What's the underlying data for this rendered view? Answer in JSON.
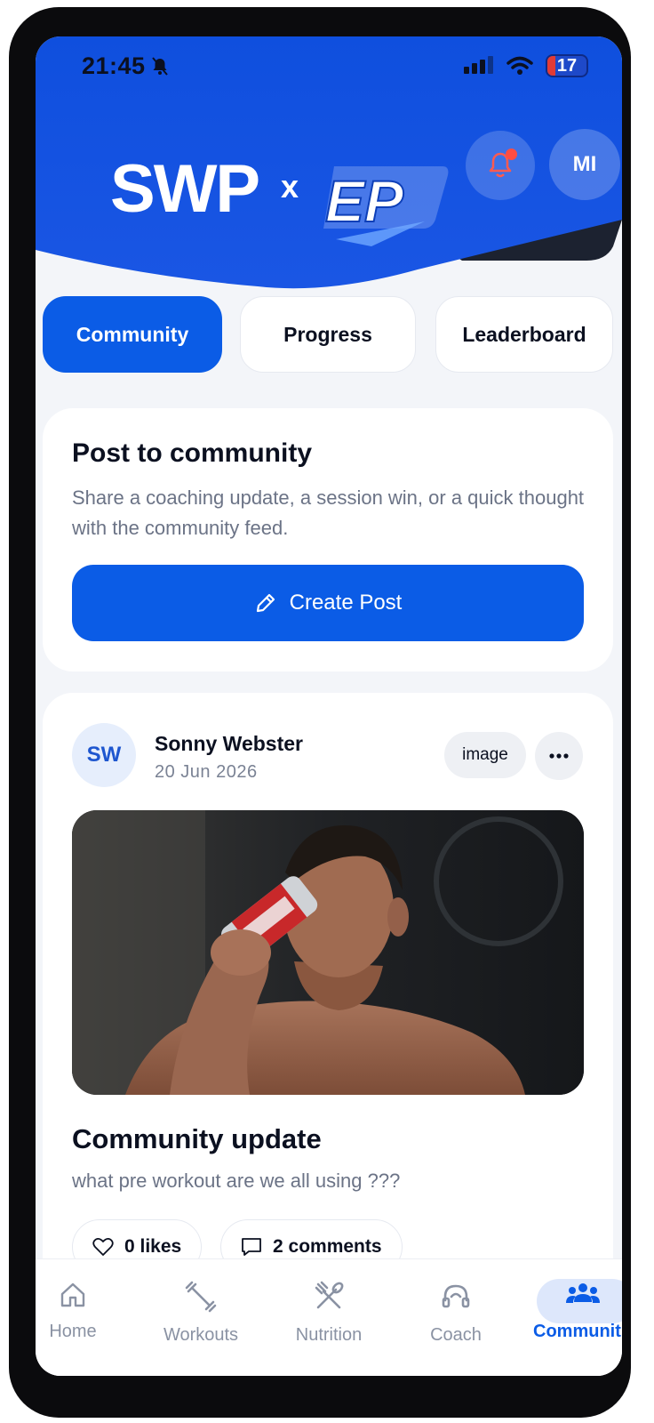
{
  "status_bar": {
    "time": "21:45",
    "battery": "17"
  },
  "header": {
    "brand_left": "SWP",
    "brand_sep": "x",
    "brand_right": "EP",
    "avatar_initials": "MI"
  },
  "tabs": [
    {
      "label": "Community",
      "active": true
    },
    {
      "label": "Progress",
      "active": false
    },
    {
      "label": "Leaderboard",
      "active": false
    }
  ],
  "composer": {
    "title": "Post to community",
    "description": "Share a coaching update, a session win, or a quick thought with the community feed.",
    "button_label": "Create Post"
  },
  "post": {
    "author_initials": "SW",
    "author_name": "Sonny Webster",
    "date": "20 Jun 2026",
    "type_chip": "image",
    "title": "Community update",
    "body": "what pre workout are we all using ???",
    "likes_label": "0 likes",
    "comments_label": "2 comments"
  },
  "bottom_nav": [
    {
      "label": "Home",
      "icon": "home-icon",
      "active": false
    },
    {
      "label": "Workouts",
      "icon": "dumbbell-icon",
      "active": false
    },
    {
      "label": "Nutrition",
      "icon": "utensils-icon",
      "active": false
    },
    {
      "label": "Coach",
      "icon": "headset-icon",
      "active": false
    },
    {
      "label": "Communit",
      "icon": "community-icon",
      "active": true
    }
  ],
  "colors": {
    "primary": "#0b5ce6",
    "header_blue": "#1552e0",
    "muted_text": "#6b7386",
    "notification_dot": "#ff4d42"
  }
}
